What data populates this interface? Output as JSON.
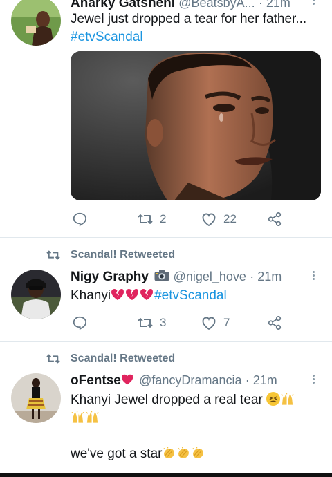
{
  "tweets": [
    {
      "author": "Anarky Gatsheni",
      "handle": "@BeatsbyA...",
      "time": "21m",
      "text": "Jewel just dropped a tear for her father...",
      "hashtag": "#etvScandal",
      "replies": "",
      "retweets": "2",
      "likes": "22",
      "image": "photo-man-tear"
    },
    {
      "retweeted_by": "Scandal! Retweeted",
      "author": "Nigy Graphy",
      "handle": "@nigel_hove",
      "time": "21m",
      "text_prefix": "Khanyi",
      "hashtag": "#etvScandal",
      "replies": "",
      "retweets": "3",
      "likes": "7"
    },
    {
      "retweeted_by": "Scandal! Retweeted",
      "author": "oFentse",
      "handle": "@fancyDramancia",
      "time": "21m",
      "line1": "Khanyi Jewel dropped a real tear",
      "line3": "we've got a star"
    }
  ],
  "colors": {
    "link": "#1b95e0",
    "secondary": "#657786",
    "divider": "#e1e8ed",
    "heart_red": "#e0245e"
  },
  "icons": [
    "reply-icon",
    "retweet-icon",
    "like-icon",
    "share-icon",
    "more-icon",
    "broken-heart-icon",
    "camera-icon",
    "clap-icon",
    "face-icon"
  ]
}
